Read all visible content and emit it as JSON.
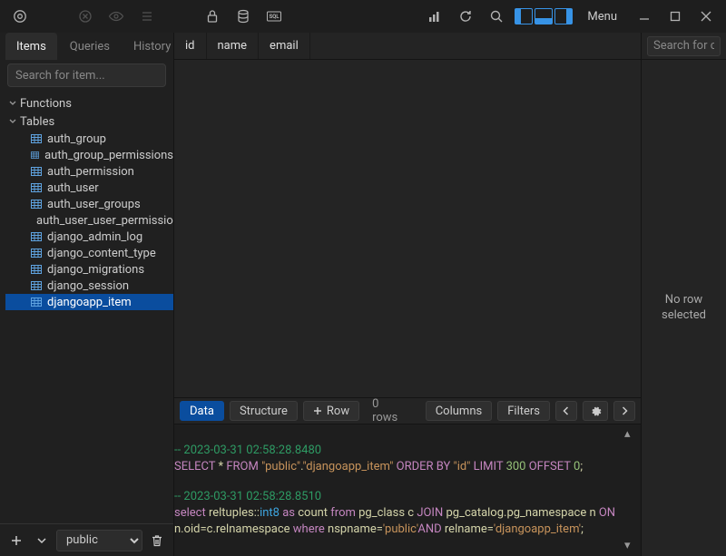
{
  "toolbar": {
    "menu_label": "Menu"
  },
  "sidebar": {
    "tabs": [
      "Items",
      "Queries",
      "History"
    ],
    "active_tab": 0,
    "search_placeholder": "Search for item...",
    "groups": [
      {
        "label": "Functions",
        "expanded": true,
        "items": []
      },
      {
        "label": "Tables",
        "expanded": true,
        "items": [
          "auth_group",
          "auth_group_permissions",
          "auth_permission",
          "auth_user",
          "auth_user_groups",
          "auth_user_user_permissions",
          "django_admin_log",
          "django_content_type",
          "django_migrations",
          "django_session",
          "djangoapp_item"
        ]
      }
    ],
    "selected_item": "djangoapp_item",
    "schema": "public"
  },
  "grid": {
    "columns": [
      "id",
      "name",
      "email"
    ]
  },
  "status": {
    "buttons": {
      "data": "Data",
      "structure": "Structure",
      "row": "Row"
    },
    "rowcount": "0 rows",
    "columns": "Columns",
    "filters": "Filters"
  },
  "inspector": {
    "search_placeholder": "Search for col",
    "message_line1": "No row",
    "message_line2": "selected"
  },
  "console": {
    "line1_ts": "-- 2023-03-31 02:58:28.8480",
    "line2": {
      "a": "SELECT",
      "b": " * ",
      "c": "FROM",
      "d": " \"public\"",
      "e": ".",
      "f": "\"djangoapp_item\"",
      "g": " ORDER BY ",
      "h": "\"id\"",
      "i": " LIMIT ",
      "j": "300",
      "k": " OFFSET ",
      "l": "0",
      "m": ";"
    },
    "line3_ts": "-- 2023-03-31 02:58:28.8510",
    "line4": {
      "a": "select",
      "b": " reltuples::",
      "c": "int8",
      "d": " as",
      "e": " count ",
      "f": "from",
      "g": " pg_class c ",
      "h": "JOIN",
      "i": " pg_catalog.pg_namespace n ",
      "j": "ON"
    },
    "line5": {
      "a": "n.oid=c.relnamespace ",
      "b": "where",
      "c": " nspname=",
      "d": "'public'",
      "e": "AND",
      "f": " relname=",
      "g": "'djangoapp_item'",
      "h": ";"
    }
  }
}
